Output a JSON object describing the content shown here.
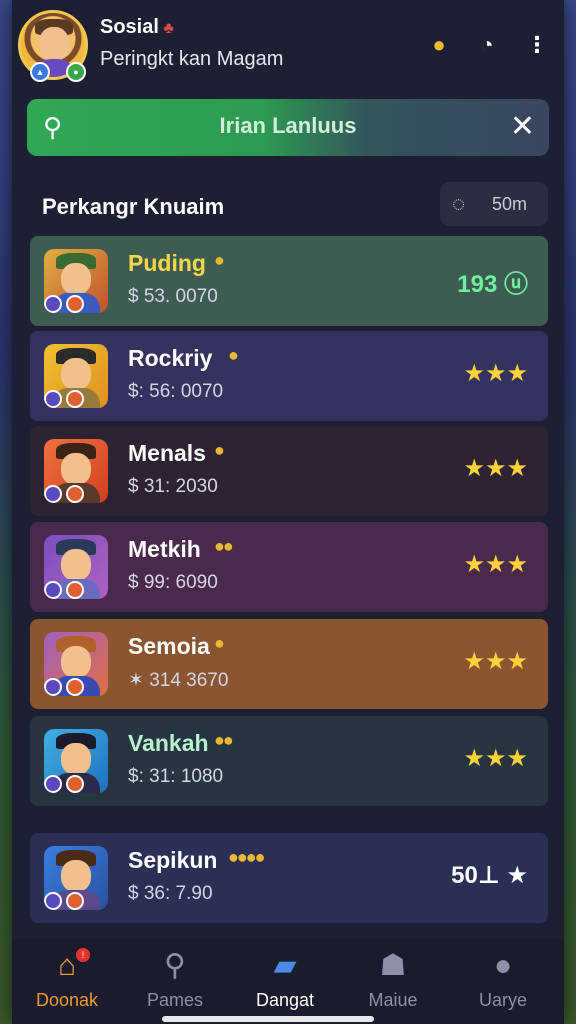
{
  "header": {
    "title": "Sosial",
    "subtitle": "Peringkt kan Magam"
  },
  "search": {
    "text": "Irian Lanluus"
  },
  "section": {
    "title": "Perkangr Knuaim",
    "button_label": "50m"
  },
  "rows": [
    {
      "name": "Puding",
      "coins": "●",
      "value": "$ 53. 0070",
      "right": "193 ⓤ",
      "bg": "#3f5c52",
      "name_color": "#f5d84a",
      "right_color": "#6ff0a0",
      "hair": "#3a6a32",
      "body": "#3a5ac0"
    },
    {
      "name": "Rockriy",
      "coins": "●",
      "value": "$: 56: 0070",
      "right": "★★★",
      "bg": "#34325e",
      "name_color": "#ffffff",
      "right_color": "#ffd23a",
      "hair": "#2a2a2a",
      "body": "#9a7a3a"
    },
    {
      "name": "Menals",
      "coins": "●",
      "value": "$ 31: 2030",
      "right": "★★★",
      "bg": "#2d2333",
      "name_color": "#ffffff",
      "right_color": "#ffd23a",
      "hair": "#3a2418",
      "body": "#5a3a2a"
    },
    {
      "name": "Metkih",
      "coins": "●●",
      "value": "$ 99: 6090",
      "right": "★★★",
      "bg": "#4a2a4c",
      "name_color": "#ffffff",
      "right_color": "#ffd23a",
      "hair": "#2a3a5a",
      "body": "#6a6ac0"
    },
    {
      "name": "Semoia",
      "coins": "●",
      "value": "✶ 314 3670",
      "right": "★★★",
      "bg": "#8a5530",
      "name_color": "#ffffff",
      "right_color": "#ffd23a",
      "hair": "#b0602a",
      "body": "#3a4ab0"
    },
    {
      "name": "Vankah",
      "coins": "●●",
      "value": "$: 31: 1080",
      "right": "★★★",
      "bg": "#273540",
      "name_color": "#b8f0d0",
      "right_color": "#ffd23a",
      "hair": "#1a1a2a",
      "body": "#2a2a4a"
    },
    {
      "name": "Sepikun",
      "coins": "●●●●",
      "value": "$ 36: 7.90",
      "right": "50⊥ ★",
      "bg": "#2c2f55",
      "name_color": "#ffffff",
      "right_color": "#ffffff",
      "hair": "#4a2a18",
      "body": "#5a4a8a"
    }
  ],
  "nav": [
    {
      "label": "Doonak",
      "icon": "home-icon"
    },
    {
      "label": "Pames",
      "icon": "search-person-icon"
    },
    {
      "label": "Dangat",
      "icon": "chat-icon"
    },
    {
      "label": "Maiue",
      "icon": "lock-icon"
    },
    {
      "label": "Uarye",
      "icon": "user-icon"
    }
  ],
  "colors": {
    "accent": "#2fa854",
    "frame": "#1d1f33",
    "gold": "#ffd23a"
  }
}
